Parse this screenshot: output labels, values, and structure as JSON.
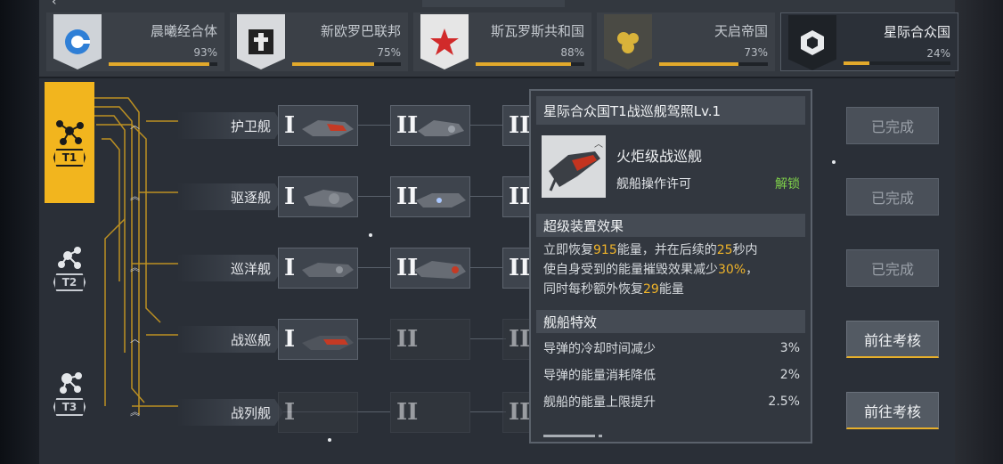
{
  "factions": [
    {
      "name": "晨曦经合体",
      "percent": "93%",
      "progress": 0.93,
      "emblem_color": "#2f7fd6",
      "icon": "circle-emblem-icon",
      "active": false
    },
    {
      "name": "新欧罗巴联邦",
      "percent": "75%",
      "progress": 0.75,
      "emblem_color": "#e9e9e9",
      "icon": "cross-emblem-icon",
      "active": false
    },
    {
      "name": "斯瓦罗斯共和国",
      "percent": "88%",
      "progress": 0.88,
      "emblem_color": "#d12a2a",
      "icon": "star-emblem-icon",
      "active": false
    },
    {
      "name": "天启帝国",
      "percent": "73%",
      "progress": 0.73,
      "emblem_color": "#b89a2a",
      "icon": "orb-emblem-icon",
      "active": false
    },
    {
      "name": "星际合众国",
      "percent": "24%",
      "progress": 0.24,
      "emblem_color": "#3a3f46",
      "icon": "hex-emblem-icon",
      "active": true
    }
  ],
  "tiers": [
    {
      "label": "T1",
      "active": true
    },
    {
      "label": "T2",
      "active": false
    },
    {
      "label": "T3",
      "active": false
    }
  ],
  "rows": [
    {
      "label": "护卫舰",
      "unlocked_slots": 3,
      "action": "已完成",
      "action_type": "done"
    },
    {
      "label": "驱逐舰",
      "unlocked_slots": 3,
      "action": "已完成",
      "action_type": "done"
    },
    {
      "label": "巡洋舰",
      "unlocked_slots": 3,
      "action": "已完成",
      "action_type": "done"
    },
    {
      "label": "战巡舰",
      "unlocked_slots": 1,
      "action": "前往考核",
      "action_type": "go"
    },
    {
      "label": "战列舰",
      "unlocked_slots": 0,
      "action": "前往考核",
      "action_type": "go"
    }
  ],
  "slot_numerals": [
    "I",
    "II",
    "III"
  ],
  "popup": {
    "title": "星际合众国T1战巡舰驾照Lv.1",
    "ship_name": "火炬级战巡舰",
    "license": "舰船操作许可",
    "unlock_label": "解锁",
    "super_section": "超级装置效果",
    "desc": {
      "p1": "立即恢复",
      "v1": "915",
      "p2": "能量，并在后续的",
      "v2": "25",
      "p3": "秒内",
      "p4": "使自身受到的能量摧毁效果减少",
      "v3": "30%",
      "p5": "，",
      "p6": "同时每秒额外恢复",
      "v4": "29",
      "p7": "能量"
    },
    "effects_section": "舰船特效",
    "effects": [
      {
        "name": "导弹的冷却时间减少",
        "value": "3%"
      },
      {
        "name": "导弹的能量消耗降低",
        "value": "2%"
      },
      {
        "name": "舰船的能量上限提升",
        "value": "2.5%"
      }
    ]
  },
  "colors": {
    "accent": "#f2b51e",
    "progress": "#e2a92b",
    "unlock": "#7fd14a",
    "highlight": "#f0b429"
  }
}
